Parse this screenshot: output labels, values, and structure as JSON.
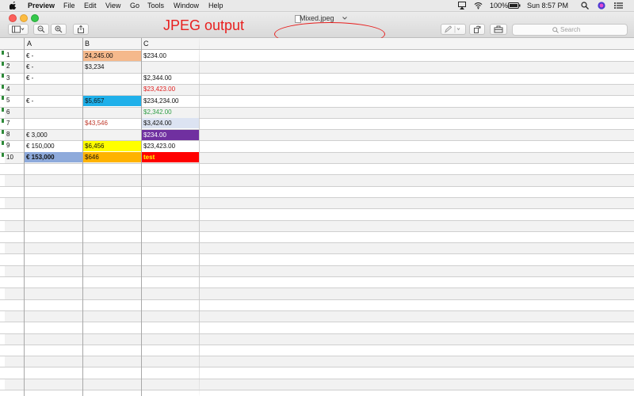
{
  "menubar": {
    "app_name": "Preview",
    "menus": [
      "File",
      "Edit",
      "View",
      "Go",
      "Tools",
      "Window",
      "Help"
    ],
    "battery": "100%",
    "clock": "Sun 8:57 PM"
  },
  "window": {
    "document_title": "Mixed.jpeg",
    "annotation_text": "JPEG output",
    "search_placeholder": "Search"
  },
  "sheet": {
    "columns": [
      "A",
      "B",
      "C"
    ],
    "rows": [
      {
        "num": "1",
        "a": "€ -",
        "b": "24,245.00",
        "c": "$234.00"
      },
      {
        "num": "2",
        "a": "€ -",
        "b": "$3,234",
        "c": ""
      },
      {
        "num": "3",
        "a": "€ -",
        "b": "",
        "c": "$2,344.00"
      },
      {
        "num": "4",
        "a": "",
        "b": "",
        "c": "$23,423.00"
      },
      {
        "num": "5",
        "a": "€ -",
        "b": "$5,657",
        "c": "$234,234.00"
      },
      {
        "num": "6",
        "a": "",
        "b": "",
        "c": "$2,342.00"
      },
      {
        "num": "7",
        "a": "",
        "b": "$43,546",
        "c": "$3,424.00"
      },
      {
        "num": "8",
        "a": "€ 3,000",
        "b": "",
        "c": "$234.00"
      },
      {
        "num": "9",
        "a": "€ 150,000",
        "b": "$6,456",
        "c": "$23,423.00"
      },
      {
        "num": "10",
        "a": "€ 153,000",
        "b": "$646",
        "c": "test"
      }
    ]
  },
  "colors": {
    "annotation_red": "#e8201f",
    "b1_fill": "#f5b98c",
    "b5_fill": "#1fb0ea",
    "b7_text": "#c0392b",
    "b9_fill": "#ffff00",
    "b10_fill": "#ffb300",
    "c4_text": "#e02020",
    "c6_text": "#2e9e44",
    "c7_fill": "#dce3f2",
    "c8_fill": "#7030a0",
    "c10_fill": "#ff0000",
    "a10_fill": "#8eaadb"
  },
  "icons": [
    "apple-icon",
    "sidebar-icon",
    "zoom-out-icon",
    "zoom-in-icon",
    "share-icon",
    "markup-icon",
    "rotate-icon",
    "toolbox-icon",
    "search-icon",
    "wifi-icon",
    "airplay-icon",
    "spotlight-icon",
    "siri-icon",
    "notification-center-icon"
  ]
}
